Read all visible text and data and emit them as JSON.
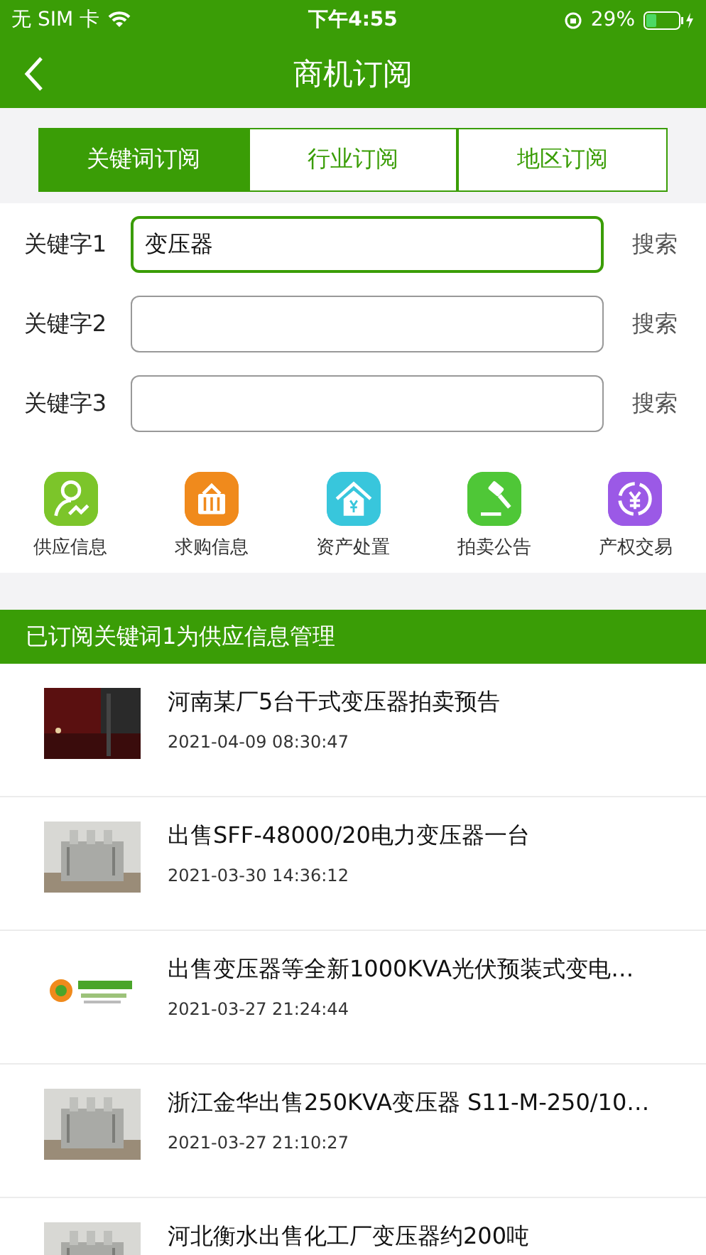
{
  "status_bar": {
    "carrier": "无 SIM 卡",
    "time": "下午4:55",
    "battery": "29%"
  },
  "nav": {
    "title": "商机订阅"
  },
  "tabs": [
    {
      "label": "关键词订阅",
      "selected": true
    },
    {
      "label": "行业订阅",
      "selected": false
    },
    {
      "label": "地区订阅",
      "selected": false
    }
  ],
  "keywords": [
    {
      "label": "关键字1",
      "value": "变压器",
      "focused": true,
      "action": "搜索"
    },
    {
      "label": "关键字2",
      "focused": false,
      "action": "搜索"
    },
    {
      "label": "关键字3",
      "focused": false,
      "action": "搜索"
    }
  ],
  "categories": [
    {
      "label": "供应信息",
      "kind": "person",
      "color": "#7cc52a"
    },
    {
      "label": "求购信息",
      "kind": "basket",
      "color": "#f08a1c"
    },
    {
      "label": "资产处置",
      "kind": "house",
      "color": "#38c6dc"
    },
    {
      "label": "拍卖公告",
      "kind": "gavel",
      "color": "#4fc737"
    },
    {
      "label": "产权交易",
      "kind": "exchange",
      "color": "#9b59e6"
    }
  ],
  "section_title": "已订阅关键词1为供应信息管理",
  "items": [
    {
      "title": "河南某厂5台干式变压器拍卖预告",
      "date": "2021-04-09 08:30:47",
      "kind": "picture"
    },
    {
      "title": "出售SFF-48000/20电力变压器一台",
      "date": "2021-03-30 14:36:12",
      "kind": "picture"
    },
    {
      "title": "出售变压器等全新1000KVA光伏预装式变电…",
      "date": "2021-03-27 21:24:44",
      "kind": "picture"
    },
    {
      "title": "浙江金华出售250KVA变压器 S11-M-250/10…",
      "date": "2021-03-27 21:10:27",
      "kind": "picture"
    },
    {
      "title": "河北衡水出售化工厂变压器约200吨",
      "kind": "picture"
    }
  ]
}
